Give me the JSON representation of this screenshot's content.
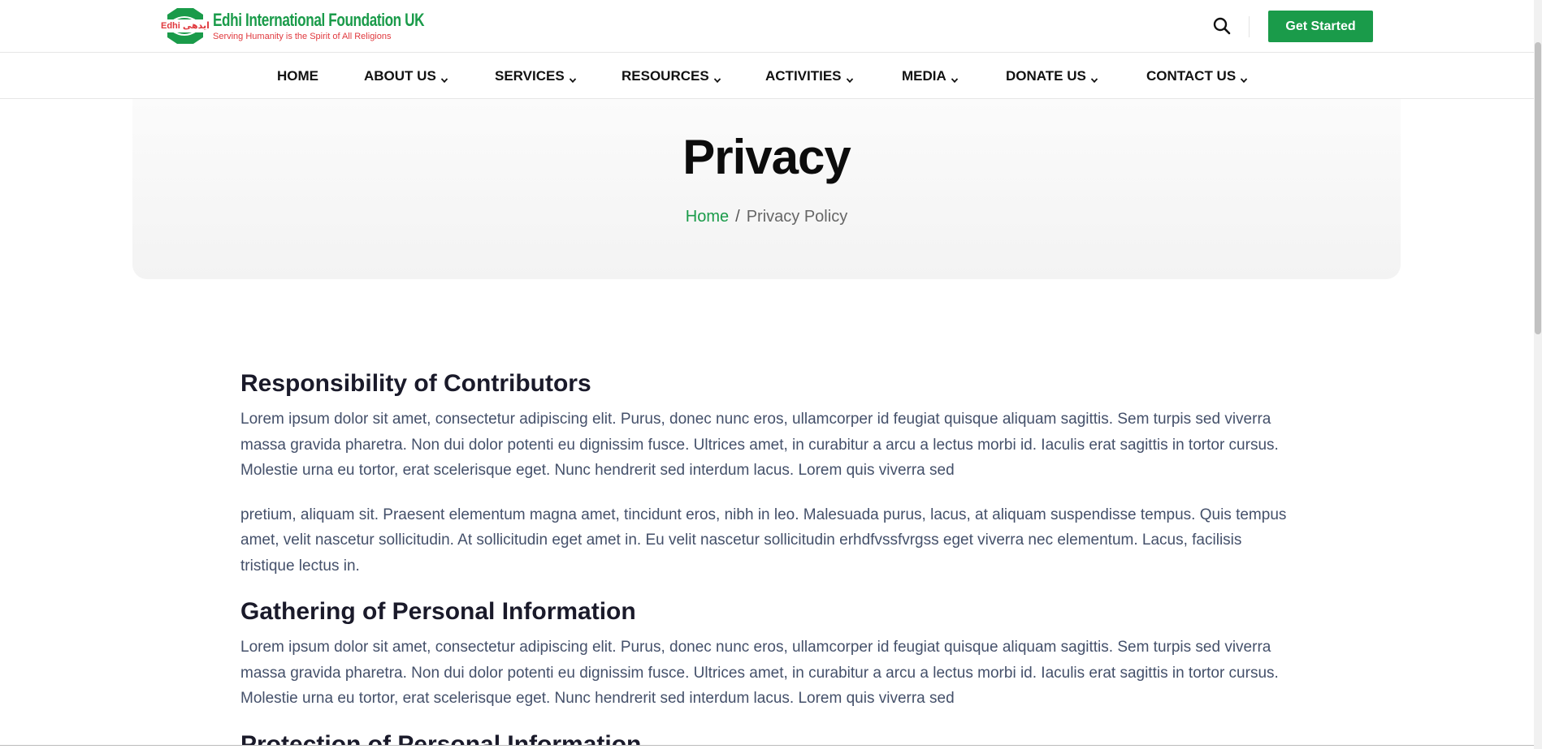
{
  "header": {
    "logo": {
      "title": "Edhi International Foundation UK",
      "tagline": "Serving Humanity is the Spirit of All Religions",
      "mark_text": "Edhi ایدھی"
    },
    "search_icon": "search-icon",
    "cta_label": "Get Started"
  },
  "nav": {
    "items": [
      {
        "label": "HOME",
        "has_dropdown": false
      },
      {
        "label": "ABOUT US",
        "has_dropdown": true
      },
      {
        "label": "SERVICES",
        "has_dropdown": true
      },
      {
        "label": "RESOURCES",
        "has_dropdown": true
      },
      {
        "label": "ACTIVITIES",
        "has_dropdown": true
      },
      {
        "label": "MEDIA",
        "has_dropdown": true
      },
      {
        "label": "DONATE US",
        "has_dropdown": true
      },
      {
        "label": "CONTACT US",
        "has_dropdown": true
      }
    ]
  },
  "hero": {
    "title": "Privacy",
    "breadcrumb": {
      "home": "Home",
      "separator": "/",
      "current": "Privacy Policy"
    }
  },
  "content": {
    "sections": [
      {
        "heading": "Responsibility of Contributors",
        "paragraphs": [
          "Lorem ipsum dolor sit amet, consectetur adipiscing elit. Purus, donec nunc eros, ullamcorper id feugiat quisque aliquam sagittis. Sem turpis sed viverra massa gravida pharetra. Non dui dolor potenti eu dignissim fusce. Ultrices amet, in curabitur a arcu a lectus morbi id. Iaculis erat sagittis in tortor cursus. Molestie urna eu tortor, erat scelerisque eget. Nunc hendrerit sed interdum lacus. Lorem quis viverra sed",
          "pretium, aliquam sit. Praesent elementum magna amet, tincidunt eros, nibh in leo. Malesuada purus, lacus, at aliquam suspendisse tempus. Quis tempus amet, velit nascetur sollicitudin. At sollicitudin eget amet in. Eu velit nascetur sollicitudin erhdfvssfvrgss eget viverra nec elementum. Lacus, facilisis tristique lectus in."
        ]
      },
      {
        "heading": "Gathering of Personal Information",
        "paragraphs": [
          "Lorem ipsum dolor sit amet, consectetur adipiscing elit. Purus, donec nunc eros, ullamcorper id feugiat quisque aliquam sagittis. Sem turpis sed viverra massa gravida pharetra. Non dui dolor potenti eu dignissim fusce. Ultrices amet, in curabitur a arcu a lectus morbi id. Iaculis erat sagittis in tortor cursus. Molestie urna eu tortor, erat scelerisque eget. Nunc hendrerit sed interdum lacus. Lorem quis viverra sed"
        ]
      },
      {
        "heading": "Protection of Personal Information",
        "paragraphs": []
      }
    ]
  },
  "colors": {
    "brand_green": "#1a9b4a",
    "brand_red": "#e0393e",
    "heading": "#1a1a2a",
    "body_text": "#44506a"
  }
}
